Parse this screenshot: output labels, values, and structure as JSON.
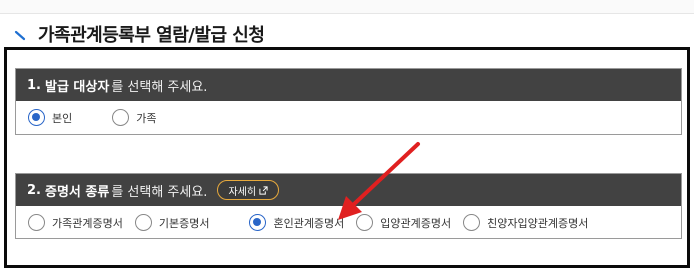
{
  "page": {
    "title": "가족관계등록부 열람/발급 신청"
  },
  "section1": {
    "number": "1.",
    "strong": "발급 대상자",
    "rest": "를 선택해 주세요.",
    "options": [
      {
        "label": "본인",
        "checked": true
      },
      {
        "label": "가족",
        "checked": false
      }
    ]
  },
  "section2": {
    "number": "2.",
    "strong": "증명서 종류",
    "rest": "를 선택해 주세요.",
    "detail_button": "자세히",
    "options": [
      {
        "label": "가족관계증명서",
        "checked": false
      },
      {
        "label": "기본증명서",
        "checked": false
      },
      {
        "label": "혼인관계증명서",
        "checked": true
      },
      {
        "label": "입양관계증명서",
        "checked": false
      },
      {
        "label": "친양자입양관계증명서",
        "checked": false
      }
    ]
  },
  "colors": {
    "header_bg": "#424242",
    "radio_checked": "#2a66c8",
    "detail_border": "#e7a93c",
    "annotation_arrow": "#e02020"
  },
  "icons": {
    "title_mark": "diagonal-stroke-icon",
    "detail_external": "external-link-icon",
    "annotation": "red-arrow-icon"
  }
}
